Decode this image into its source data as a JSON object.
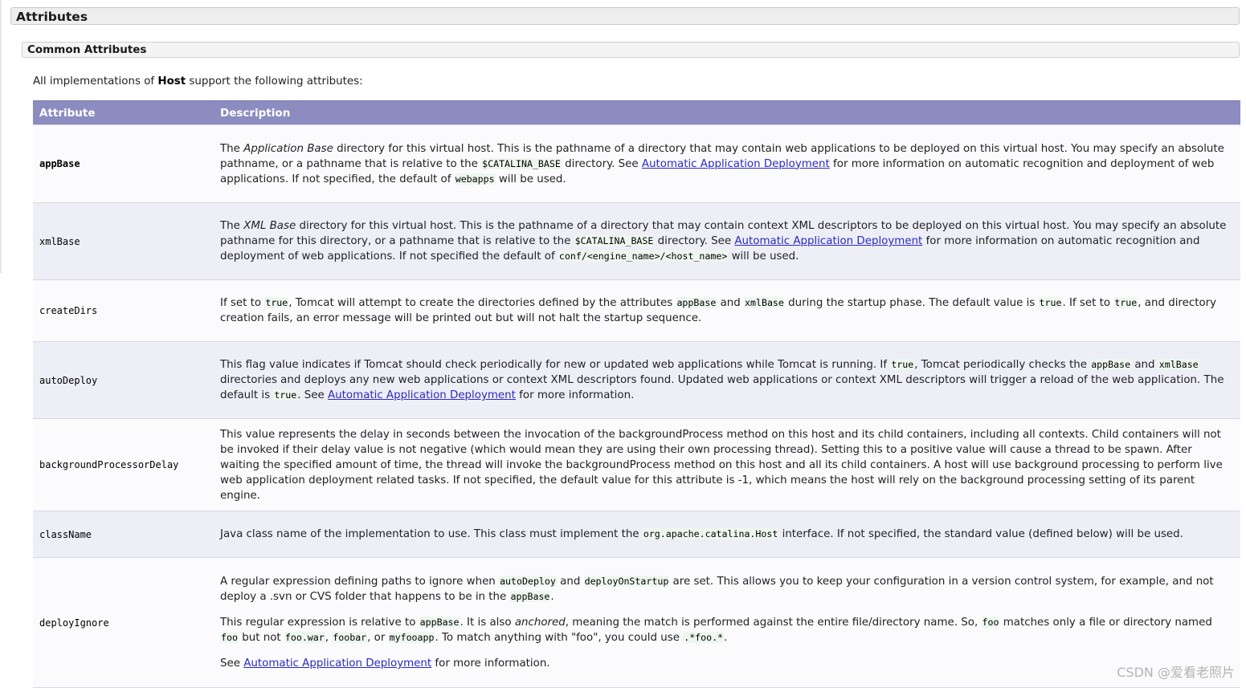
{
  "section": {
    "title": "Attributes"
  },
  "subsection": {
    "title": "Common Attributes"
  },
  "intro": {
    "before": "All implementations of ",
    "bold": "Host",
    "after": " support the following attributes:"
  },
  "table": {
    "headers": {
      "attribute": "Attribute",
      "description": "Description"
    },
    "rows": [
      {
        "name": "appBase",
        "paragraphs": [
          [
            [
              "t",
              "The "
            ],
            [
              "i",
              "Application Base"
            ],
            [
              "t",
              " directory for this virtual host. This is the pathname of a directory that may contain web applications to be deployed on this virtual host. You may specify an absolute pathname, or a pathname that is relative to the "
            ],
            [
              "c",
              "$CATALINA_BASE"
            ],
            [
              "t",
              " directory. See "
            ],
            [
              "a",
              "Automatic Application Deployment"
            ],
            [
              "t",
              " for more information on automatic recognition and deployment of web applications. If not specified, the default of "
            ],
            [
              "c",
              "webapps"
            ],
            [
              "t",
              " will be used."
            ]
          ]
        ]
      },
      {
        "name": "xmlBase",
        "paragraphs": [
          [
            [
              "t",
              "The "
            ],
            [
              "i",
              "XML Base"
            ],
            [
              "t",
              " directory for this virtual host. This is the pathname of a directory that may contain context XML descriptors to be deployed on this virtual host. You may specify an absolute pathname for this directory, or a pathname that is relative to the "
            ],
            [
              "c",
              "$CATALINA_BASE"
            ],
            [
              "t",
              " directory. See "
            ],
            [
              "a",
              "Automatic Application Deployment"
            ],
            [
              "t",
              " for more information on automatic recognition and deployment of web applications. If not specified the default of "
            ],
            [
              "c",
              "conf/<engine_name>/<host_name>"
            ],
            [
              "t",
              " will be used."
            ]
          ]
        ]
      },
      {
        "name": "createDirs",
        "paragraphs": [
          [
            [
              "t",
              "If set to "
            ],
            [
              "c",
              "true"
            ],
            [
              "t",
              ", Tomcat will attempt to create the directories defined by the attributes "
            ],
            [
              "c",
              "appBase"
            ],
            [
              "t",
              " and "
            ],
            [
              "c",
              "xmlBase"
            ],
            [
              "t",
              " during the startup phase. The default value is "
            ],
            [
              "c",
              "true"
            ],
            [
              "t",
              ". If set to "
            ],
            [
              "c",
              "true"
            ],
            [
              "t",
              ", and directory creation fails, an error message will be printed out but will not halt the startup sequence."
            ]
          ]
        ]
      },
      {
        "name": "autoDeploy",
        "paragraphs": [
          [
            [
              "t",
              "This flag value indicates if Tomcat should check periodically for new or updated web applications while Tomcat is running. If "
            ],
            [
              "c",
              "true"
            ],
            [
              "t",
              ", Tomcat periodically checks the "
            ],
            [
              "c",
              "appBase"
            ],
            [
              "t",
              " and "
            ],
            [
              "c",
              "xmlBase"
            ],
            [
              "t",
              " directories and deploys any new web applications or context XML descriptors found. Updated web applications or context XML descriptors will trigger a reload of the web application. The default is "
            ],
            [
              "c",
              "true"
            ],
            [
              "t",
              ". See "
            ],
            [
              "a",
              "Automatic Application Deployment"
            ],
            [
              "t",
              " for more information."
            ]
          ]
        ]
      },
      {
        "name": "backgroundProcessorDelay",
        "paragraphs": [
          [
            [
              "t",
              "This value represents the delay in seconds between the invocation of the backgroundProcess method on this host and its child containers, including all contexts. Child containers will not be invoked if their delay value is not negative (which would mean they are using their own processing thread). Setting this to a positive value will cause a thread to be spawn. After waiting the specified amount of time, the thread will invoke the backgroundProcess method on this host and all its child containers. A host will use background processing to perform live web application deployment related tasks. If not specified, the default value for this attribute is -1, which means the host will rely on the background processing setting of its parent engine."
            ]
          ]
        ]
      },
      {
        "name": "className",
        "paragraphs": [
          [
            [
              "t",
              "Java class name of the implementation to use. This class must implement the "
            ],
            [
              "c",
              "org.apache.catalina.Host"
            ],
            [
              "t",
              " interface. If not specified, the standard value (defined below) will be used."
            ]
          ]
        ]
      },
      {
        "name": "deployIgnore",
        "paragraphs": [
          [
            [
              "t",
              "A regular expression defining paths to ignore when "
            ],
            [
              "c",
              "autoDeploy"
            ],
            [
              "t",
              " and "
            ],
            [
              "c",
              "deployOnStartup"
            ],
            [
              "t",
              " are set. This allows you to keep your configuration in a version control system, for example, and not deploy a .svn or CVS folder that happens to be in the "
            ],
            [
              "c",
              "appBase"
            ],
            [
              "t",
              "."
            ]
          ],
          [
            [
              "t",
              "This regular expression is relative to "
            ],
            [
              "c",
              "appBase"
            ],
            [
              "t",
              ". It is also "
            ],
            [
              "i",
              "anchored"
            ],
            [
              "t",
              ", meaning the match is performed against the entire file/directory name. So, "
            ],
            [
              "c",
              "foo"
            ],
            [
              "t",
              " matches only a file or directory named "
            ],
            [
              "c",
              "foo"
            ],
            [
              "t",
              " but not "
            ],
            [
              "c",
              "foo.war"
            ],
            [
              "t",
              ", "
            ],
            [
              "c",
              "foobar"
            ],
            [
              "t",
              ", or "
            ],
            [
              "c",
              "myfooapp"
            ],
            [
              "t",
              ". To match anything with \"foo\", you could use "
            ],
            [
              "c",
              ".*foo.*"
            ],
            [
              "t",
              "."
            ]
          ],
          [
            [
              "t",
              "See "
            ],
            [
              "a",
              "Automatic Application Deployment"
            ],
            [
              "t",
              " for more information."
            ]
          ]
        ]
      }
    ]
  },
  "watermark": "CSDN @爱看老照片"
}
